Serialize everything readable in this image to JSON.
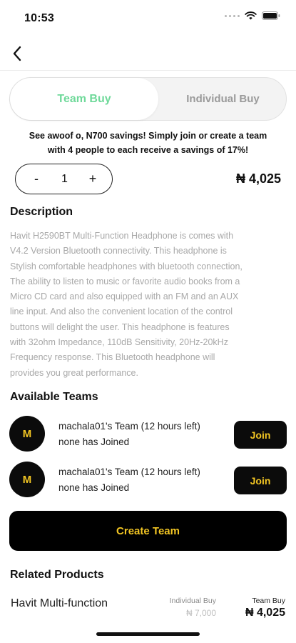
{
  "status": {
    "time": "10:53"
  },
  "tabs": {
    "active": "Team Buy",
    "inactive": "Individual Buy"
  },
  "promo": {
    "line1": "See awoof o, N700 savings! Simply join or create a team",
    "line2": "with 4 people to each receive a savings of 17%!"
  },
  "quantity": {
    "minus": "-",
    "value": "1",
    "plus": "+"
  },
  "price": "₦ 4,025",
  "description": {
    "heading": "Description",
    "lines": [
      "Havit H2590BT Multi-Function Headphone is comes with",
      "V4.2 Version Bluetooth connectivity. This headphone is",
      "Stylish comfortable headphones with bluetooth connection,",
      "The ability to listen to music or favorite audio books from a",
      "Micro CD card and also equipped with an FM and an AUX",
      "line input. And also the convenient location of the control",
      "buttons will delight the user. This headphone is features",
      "with 32ohm Impedance, 110dB Sensitivity, 20Hz-20kHz",
      "Frequency response. This Bluetooth headphone will",
      "provides you great performance."
    ]
  },
  "teams": {
    "heading": "Available Teams",
    "items": [
      {
        "initial": "M",
        "title": "machala01's Team (12 hours left)",
        "status": "none has Joined",
        "join_label": "Join"
      },
      {
        "initial": "M",
        "title": "machala01's Team (12 hours left)",
        "status": "none has Joined",
        "join_label": "Join"
      }
    ]
  },
  "create_team_label": "Create Team",
  "related": {
    "heading": "Related Products",
    "product_name": "Havit Multi-function",
    "individual_label": "Individual Buy",
    "individual_price": "₦ 7,000",
    "team_label": "Team Buy",
    "team_price": "₦ 4,025"
  },
  "colors": {
    "accent_green": "#6fd99a",
    "accent_yellow": "#f3c623",
    "dark": "#0b0b0b"
  }
}
